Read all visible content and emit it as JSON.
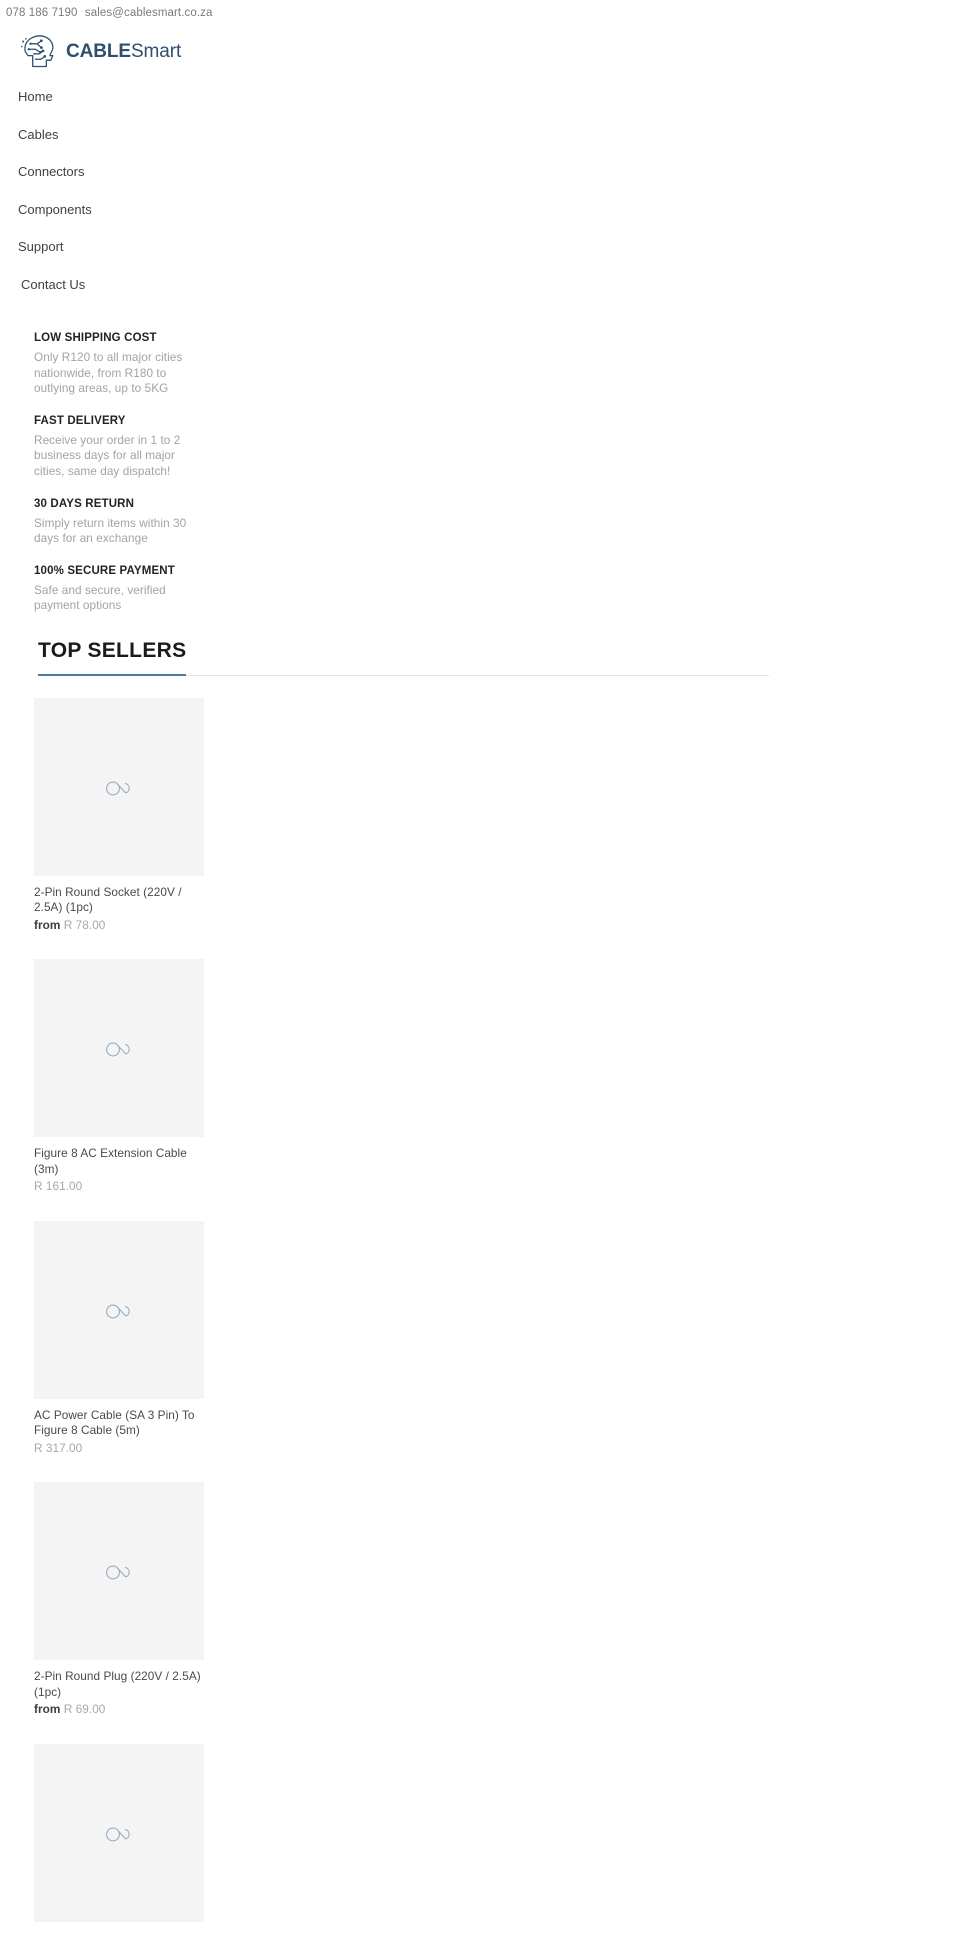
{
  "topbar": {
    "phone": "078 186 7190",
    "email": "sales@cablesmart.co.za"
  },
  "brand": {
    "name_bold": "CABLE",
    "name_light": "Smart",
    "logo_icon": "head-circuit-logo-icon",
    "accent_color": "#2e4f6e"
  },
  "nav": {
    "items": [
      {
        "label": "Home"
      },
      {
        "label": "Cables"
      },
      {
        "label": "Connectors"
      },
      {
        "label": "Components"
      },
      {
        "label": "Support"
      },
      {
        "label": "Contact Us"
      }
    ]
  },
  "features": [
    {
      "title": "LOW SHIPPING COST",
      "desc": "Only R120 to all major cities nationwide, from R180 to outlying areas, up to 5KG"
    },
    {
      "title": "FAST DELIVERY",
      "desc": "Receive your order in 1 to 2 business days for all major cities, same day dispatch!"
    },
    {
      "title": "30 DAYS RETURN",
      "desc": "Simply return items within 30 days for an exchange"
    },
    {
      "title": "100% SECURE PAYMENT",
      "desc": "Safe and secure, verified payment options"
    }
  ],
  "top_sellers": {
    "heading": "TOP SELLERS",
    "underline_color": "#4b7ba5",
    "products": [
      {
        "name": "2-Pin Round Socket (220V / 2.5A) (1pc)",
        "price_prefix": "from",
        "price": "R 78.00",
        "thumb_icon": "loading-spinner-icon"
      },
      {
        "name": "Figure 8 AC Extension Cable (3m)",
        "price_prefix": "",
        "price": "R 161.00",
        "thumb_icon": "loading-spinner-icon"
      },
      {
        "name": "AC Power Cable (SA 3 Pin) To Figure 8 Cable (5m)",
        "price_prefix": "",
        "price": "R 317.00",
        "thumb_icon": "loading-spinner-icon"
      },
      {
        "name": "2-Pin Round Plug (220V / 2.5A) (1pc)",
        "price_prefix": "from",
        "price": "R 69.00",
        "thumb_icon": "loading-spinner-icon"
      },
      {
        "name": "",
        "price_prefix": "",
        "price": "",
        "thumb_icon": "loading-spinner-icon"
      }
    ]
  }
}
